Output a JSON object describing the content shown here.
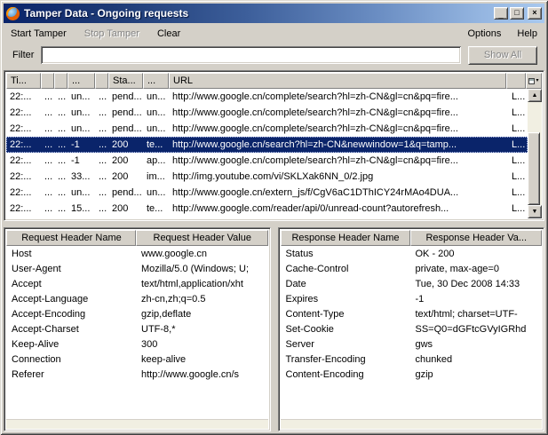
{
  "window": {
    "title": "Tamper Data - Ongoing requests",
    "controls": {
      "minimize": "_",
      "maximize": "□",
      "close": "×"
    }
  },
  "menu": {
    "start_tamper": "Start Tamper",
    "stop_tamper": "Stop Tamper",
    "clear": "Clear",
    "options": "Options",
    "help": "Help"
  },
  "filter": {
    "label": "Filter",
    "value": "",
    "show_all": "Show All"
  },
  "requests": {
    "columns": {
      "time": "Ti...",
      "dur": "",
      "total": "",
      "size": "...",
      "method": "",
      "status": "Sta...",
      "ctype": "...",
      "url": "URL",
      "flags": ""
    },
    "scroll": {
      "up": "▲",
      "down": "▼"
    },
    "rows": [
      {
        "time": "22:...",
        "dur": "...",
        "total": "...",
        "size": "un...",
        "method": "...",
        "status": "pend...",
        "ctype": "un...",
        "url": "http://www.google.cn/complete/search?hl=zh-CN&gl=cn&pq=fire...",
        "flags": "L..."
      },
      {
        "time": "22:...",
        "dur": "...",
        "total": "...",
        "size": "un...",
        "method": "...",
        "status": "pend...",
        "ctype": "un...",
        "url": "http://www.google.cn/complete/search?hl=zh-CN&gl=cn&pq=fire...",
        "flags": "L..."
      },
      {
        "time": "22:...",
        "dur": "...",
        "total": "...",
        "size": "un...",
        "method": "...",
        "status": "pend...",
        "ctype": "un...",
        "url": "http://www.google.cn/complete/search?hl=zh-CN&gl=cn&pq=fire...",
        "flags": "L..."
      },
      {
        "time": "22:...",
        "dur": "...",
        "total": "...",
        "size": "-1",
        "method": "...",
        "status": "200",
        "ctype": "te...",
        "url": "http://www.google.cn/search?hl=zh-CN&newwindow=1&q=tamp...",
        "flags": "L..."
      },
      {
        "time": "22:...",
        "dur": "...",
        "total": "...",
        "size": "-1",
        "method": "...",
        "status": "200",
        "ctype": "ap...",
        "url": "http://www.google.cn/complete/search?hl=zh-CN&gl=cn&pq=fire...",
        "flags": "L..."
      },
      {
        "time": "22:...",
        "dur": "...",
        "total": "...",
        "size": "33...",
        "method": "...",
        "status": "200",
        "ctype": "im...",
        "url": "http://img.youtube.com/vi/SKLXak6NN_0/2.jpg",
        "flags": "L..."
      },
      {
        "time": "22:...",
        "dur": "...",
        "total": "...",
        "size": "un...",
        "method": "...",
        "status": "pend...",
        "ctype": "un...",
        "url": "http://www.google.cn/extern_js/f/CgV6aC1DThICY24rMAo4DUA...",
        "flags": "L..."
      },
      {
        "time": "22:...",
        "dur": "...",
        "total": "...",
        "size": "15...",
        "method": "...",
        "status": "200",
        "ctype": "te...",
        "url": "http://www.google.com/reader/api/0/unread-count?autorefresh...",
        "flags": "L..."
      }
    ]
  },
  "request_headers": {
    "col_name": "Request Header Name",
    "col_value": "Request Header Value",
    "rows": [
      {
        "name": "Host",
        "value": "www.google.cn"
      },
      {
        "name": "User-Agent",
        "value": "Mozilla/5.0 (Windows; U;"
      },
      {
        "name": "Accept",
        "value": "text/html,application/xht"
      },
      {
        "name": "Accept-Language",
        "value": "zh-cn,zh;q=0.5"
      },
      {
        "name": "Accept-Encoding",
        "value": "gzip,deflate"
      },
      {
        "name": "Accept-Charset",
        "value": "UTF-8,*"
      },
      {
        "name": "Keep-Alive",
        "value": "300"
      },
      {
        "name": "Connection",
        "value": "keep-alive"
      },
      {
        "name": "Referer",
        "value": "http://www.google.cn/s"
      }
    ]
  },
  "response_headers": {
    "col_name": "Response Header Name",
    "col_value": "Response Header Va...",
    "rows": [
      {
        "name": "Status",
        "value": "OK - 200"
      },
      {
        "name": "Cache-Control",
        "value": "private, max-age=0"
      },
      {
        "name": "Date",
        "value": "Tue, 30 Dec 2008 14:33"
      },
      {
        "name": "Expires",
        "value": "-1"
      },
      {
        "name": "Content-Type",
        "value": "text/html; charset=UTF-"
      },
      {
        "name": "Set-Cookie",
        "value": "SS=Q0=dGFtcGVyIGRhd"
      },
      {
        "name": "Server",
        "value": "gws"
      },
      {
        "name": "Transfer-Encoding",
        "value": "chunked"
      },
      {
        "name": "Content-Encoding",
        "value": "gzip"
      }
    ]
  },
  "colors": {
    "titlebar_start": "#0a246a",
    "titlebar_end": "#a8c8ee",
    "selection": "#0a246a",
    "window_face": "#d4d0c8"
  }
}
